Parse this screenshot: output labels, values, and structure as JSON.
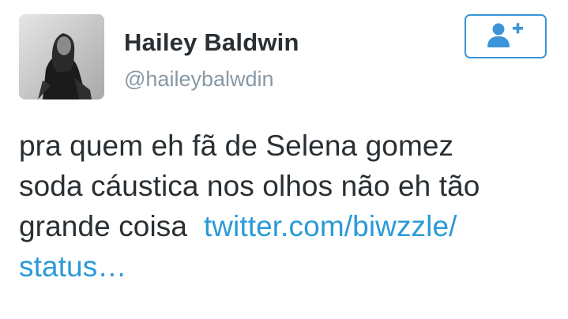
{
  "tweet": {
    "author": {
      "display_name": "Hailey Baldwin",
      "handle": "@haileybalwdin",
      "avatar_icon": "profile-photo"
    },
    "follow_button": {
      "icon": "follow-user-plus-icon",
      "color": "#3b94d9"
    },
    "text": {
      "line1": "pra quem eh fã de Selena gomez",
      "line2": "soda cáustica nos olhos não eh tão",
      "line3": "grande coisa ",
      "link_part1": "twitter.com/biwzzle/",
      "link_part2": "status…"
    },
    "colors": {
      "name": "#292f33",
      "handle": "#8899a6",
      "link": "#2b9ad8"
    }
  }
}
